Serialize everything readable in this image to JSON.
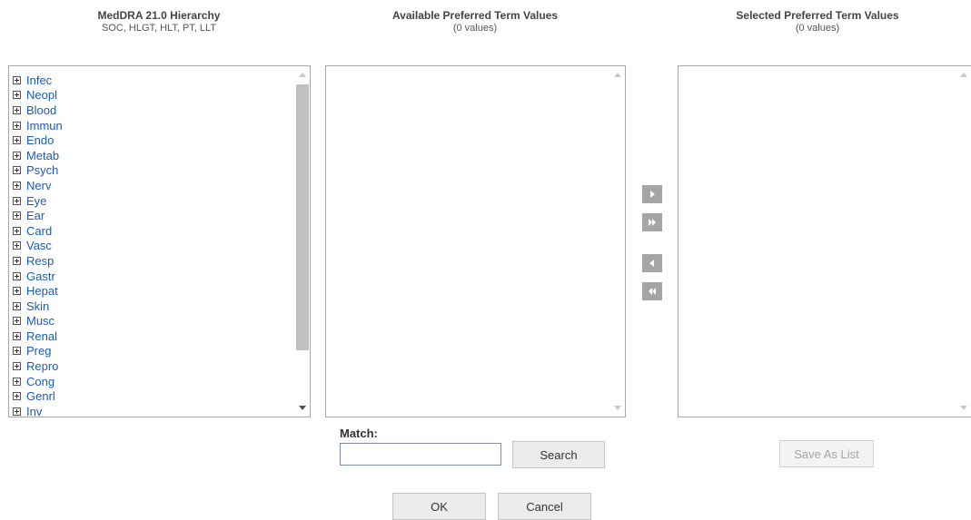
{
  "hierarchy": {
    "title": "MedDRA 21.0 Hierarchy",
    "subtitle": "SOC, HLGT, HLT, PT, LLT",
    "items": [
      "Infec",
      "Neopl",
      "Blood",
      "Immun",
      "Endo",
      "Metab",
      "Psych",
      "Nerv",
      "Eye",
      "Ear",
      "Card",
      "Vasc",
      "Resp",
      "Gastr",
      "Hepat",
      "Skin",
      "Musc",
      "Renal",
      "Preg",
      "Repro",
      "Cong",
      "Genrl",
      "Inv"
    ]
  },
  "available": {
    "title": "Available Preferred Term Values",
    "count": "(0 values)"
  },
  "selected": {
    "title": "Selected Preferred Term Values",
    "count": "(0 values)"
  },
  "match": {
    "label": "Match:",
    "value": "",
    "placeholder": ""
  },
  "buttons": {
    "search": "Search",
    "save_as_list": "Save As List",
    "ok": "OK",
    "cancel": "Cancel"
  },
  "transfer_icons": [
    "move-right-icon",
    "move-all-right-icon",
    "move-left-icon",
    "move-all-left-icon"
  ]
}
